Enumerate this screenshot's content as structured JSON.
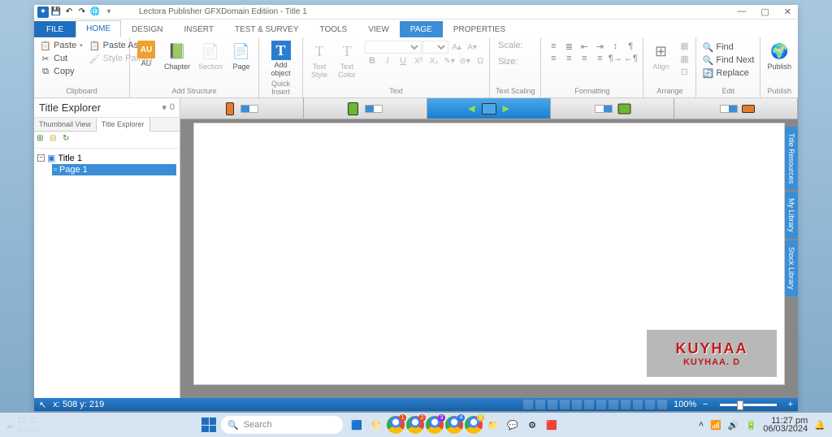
{
  "titlebar": {
    "title": "Lectora Publisher GFXDomain Editiion - Title 1"
  },
  "window": {
    "min": "—",
    "max": "▢",
    "close": "✕"
  },
  "tabs": {
    "file": "FILE",
    "home": "HOME",
    "design": "DESIGN",
    "insert": "INSERT",
    "test": "TEST & SURVEY",
    "tools": "TOOLS",
    "view": "VIEW",
    "page": "PAGE",
    "properties": "PROPERTIES"
  },
  "ribbon": {
    "clipboard": {
      "label": "Clipboard",
      "paste": "Paste",
      "pasteAs": "Paste As",
      "cut": "Cut",
      "copy": "Copy",
      "stylePainter": "Style Painter"
    },
    "addStructure": {
      "label": "Add Structure",
      "au": "AU",
      "chapter": "Chapter",
      "section": "Section",
      "page": "Page"
    },
    "quickInsert": {
      "label": "Quick Insert",
      "addObject": "Add object"
    },
    "text": {
      "label": "Text",
      "textStyle": "Text Style",
      "textColor": "Text\nColor"
    },
    "textScaling": {
      "label": "Text Scaling",
      "scale": "Scale:",
      "size": "Size:"
    },
    "formatting": {
      "label": "Formatting"
    },
    "arrange": {
      "label": "Arrange",
      "align": "Align"
    },
    "edit": {
      "label": "Edit",
      "find": "Find",
      "findNext": "Find Next",
      "replace": "Replace"
    },
    "publish": {
      "label": "Publish",
      "btn": "Publish"
    }
  },
  "explorer": {
    "title": "Title Explorer",
    "pin": "▾",
    "count": "0",
    "tabs": {
      "thumb": "Thumbnail View",
      "title": "Title Explorer"
    },
    "root": "Title 1",
    "page": "Page 1"
  },
  "sideTabs": {
    "res": "Title Resources",
    "lib": "My Library",
    "stock": "Stock Library"
  },
  "watermark": {
    "l1": "KUYHAA",
    "l2": "KUYHAA. D"
  },
  "status": {
    "coords": "x: 508  y: 219",
    "zoom": "100%"
  },
  "taskbar": {
    "temp": "15°C",
    "cond": "Smoke",
    "search": "Search",
    "time": "11:27 pm",
    "date": "06/03/2024"
  }
}
